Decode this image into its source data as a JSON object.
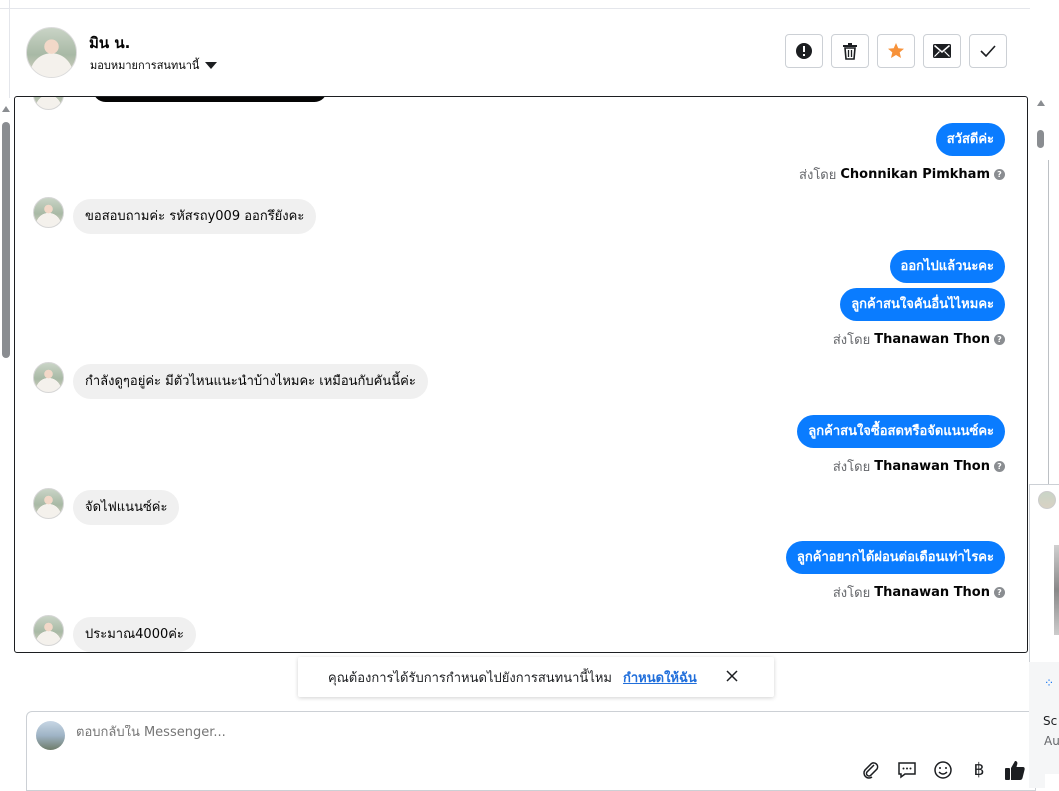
{
  "contact": {
    "name": "มิน น.",
    "assign_label": "มอบหมายการสนทนานี้"
  },
  "actions": [
    {
      "name": "mark-spam-button",
      "icon": "exclamation-circle-icon"
    },
    {
      "name": "delete-button",
      "icon": "trash-icon"
    },
    {
      "name": "star-button",
      "icon": "star-icon",
      "color": "#f7923a"
    },
    {
      "name": "mark-unread-button",
      "icon": "envelope-icon"
    },
    {
      "name": "mark-done-button",
      "icon": "check-icon"
    }
  ],
  "messages": {
    "m1": "สวัสดีค่ะ",
    "sent1_prefix": "ส่งโดย",
    "sent1_name": "Chonnikan Pimkham",
    "m2": "ขอสอบถามค่ะ รหัสรถy009 ออกรึยังคะ",
    "m3": "ออกไปแล้วนะคะ",
    "m4": "ลูกค้าสนใจคันอื่นไไหมคะ",
    "sent2_prefix": "ส่งโดย",
    "sent2_name": "Thanawan Thon",
    "m5": "กำลังดูๆอยู่ค่ะ มีตัวไหนแนะนำบ้างไหมคะ เหมือนกับคันนี้ค่ะ",
    "m6": "ลูกค้าสนใจซื้อสดหรือจัดแนนซ์คะ",
    "sent3_prefix": "ส่งโดย",
    "sent3_name": "Thanawan Thon",
    "m7": "จัดไฟแนนซ์ค่ะ",
    "m8": "ลูกค้าอยากได้ผ่อนต่อเดือนเท่าไรคะ",
    "sent4_prefix": "ส่งโดย",
    "sent4_name": "Thanawan Thon",
    "m9": "ประมาณ4000ค่ะ"
  },
  "notice": {
    "text": "คุณต้องการได้รับการกำหนดไปยังการสนทนานี้ไหม",
    "link": "กำหนดให้ฉัน"
  },
  "reply": {
    "placeholder": "ตอบกลับใน Messenger..."
  },
  "reply_tools": [
    "paperclip-icon",
    "chat-bubble-icon",
    "emoji-icon",
    "baht-icon",
    "thumbs-up-icon"
  ],
  "side_panel": {
    "text1": "Sc",
    "text2": "Au"
  },
  "colors": {
    "outgoing_bubble": "#0a7cff",
    "incoming_bubble": "#f0f0f0",
    "link": "#216fdb",
    "star": "#f7923a"
  }
}
